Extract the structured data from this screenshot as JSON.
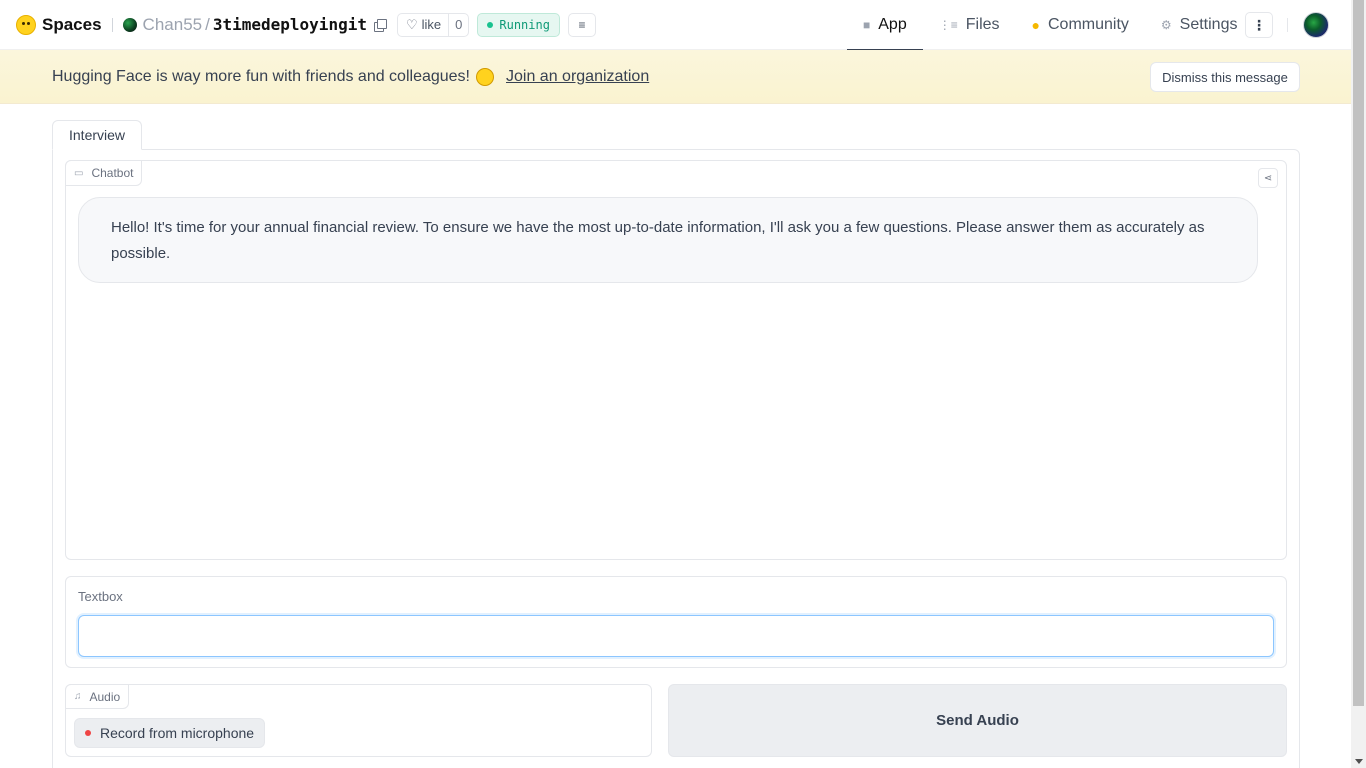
{
  "topbar": {
    "brand": "Spaces",
    "owner": "Chan55",
    "separator": "/",
    "repo": "3timedeployingit",
    "like_label": "like",
    "like_count": "0",
    "status": "Running",
    "nav": [
      {
        "label": "App",
        "icon": "cube-icon",
        "active": true
      },
      {
        "label": "Files",
        "icon": "files-icon"
      },
      {
        "label": "Community",
        "icon": "hug-hand-icon"
      },
      {
        "label": "Settings",
        "icon": "gear-icon"
      }
    ]
  },
  "banner": {
    "message": "Hugging Face is way more fun with friends and colleagues!",
    "link": "Join an organization",
    "dismiss": "Dismiss this message"
  },
  "app": {
    "tab": "Interview",
    "chatbot": {
      "label": "Chatbot",
      "messages": [
        "Hello! It's time for your annual financial review. To ensure we have the most up-to-date information, I'll ask you a few questions. Please answer them as accurately as possible."
      ]
    },
    "textbox": {
      "label": "Textbox",
      "value": ""
    },
    "audio": {
      "label": "Audio",
      "record": "Record from microphone"
    },
    "send": "Send Audio"
  },
  "colors": {
    "accent_status": "#0f9a77",
    "banner_bg": "#faf3d0",
    "focus_border": "#8cc6ff"
  }
}
